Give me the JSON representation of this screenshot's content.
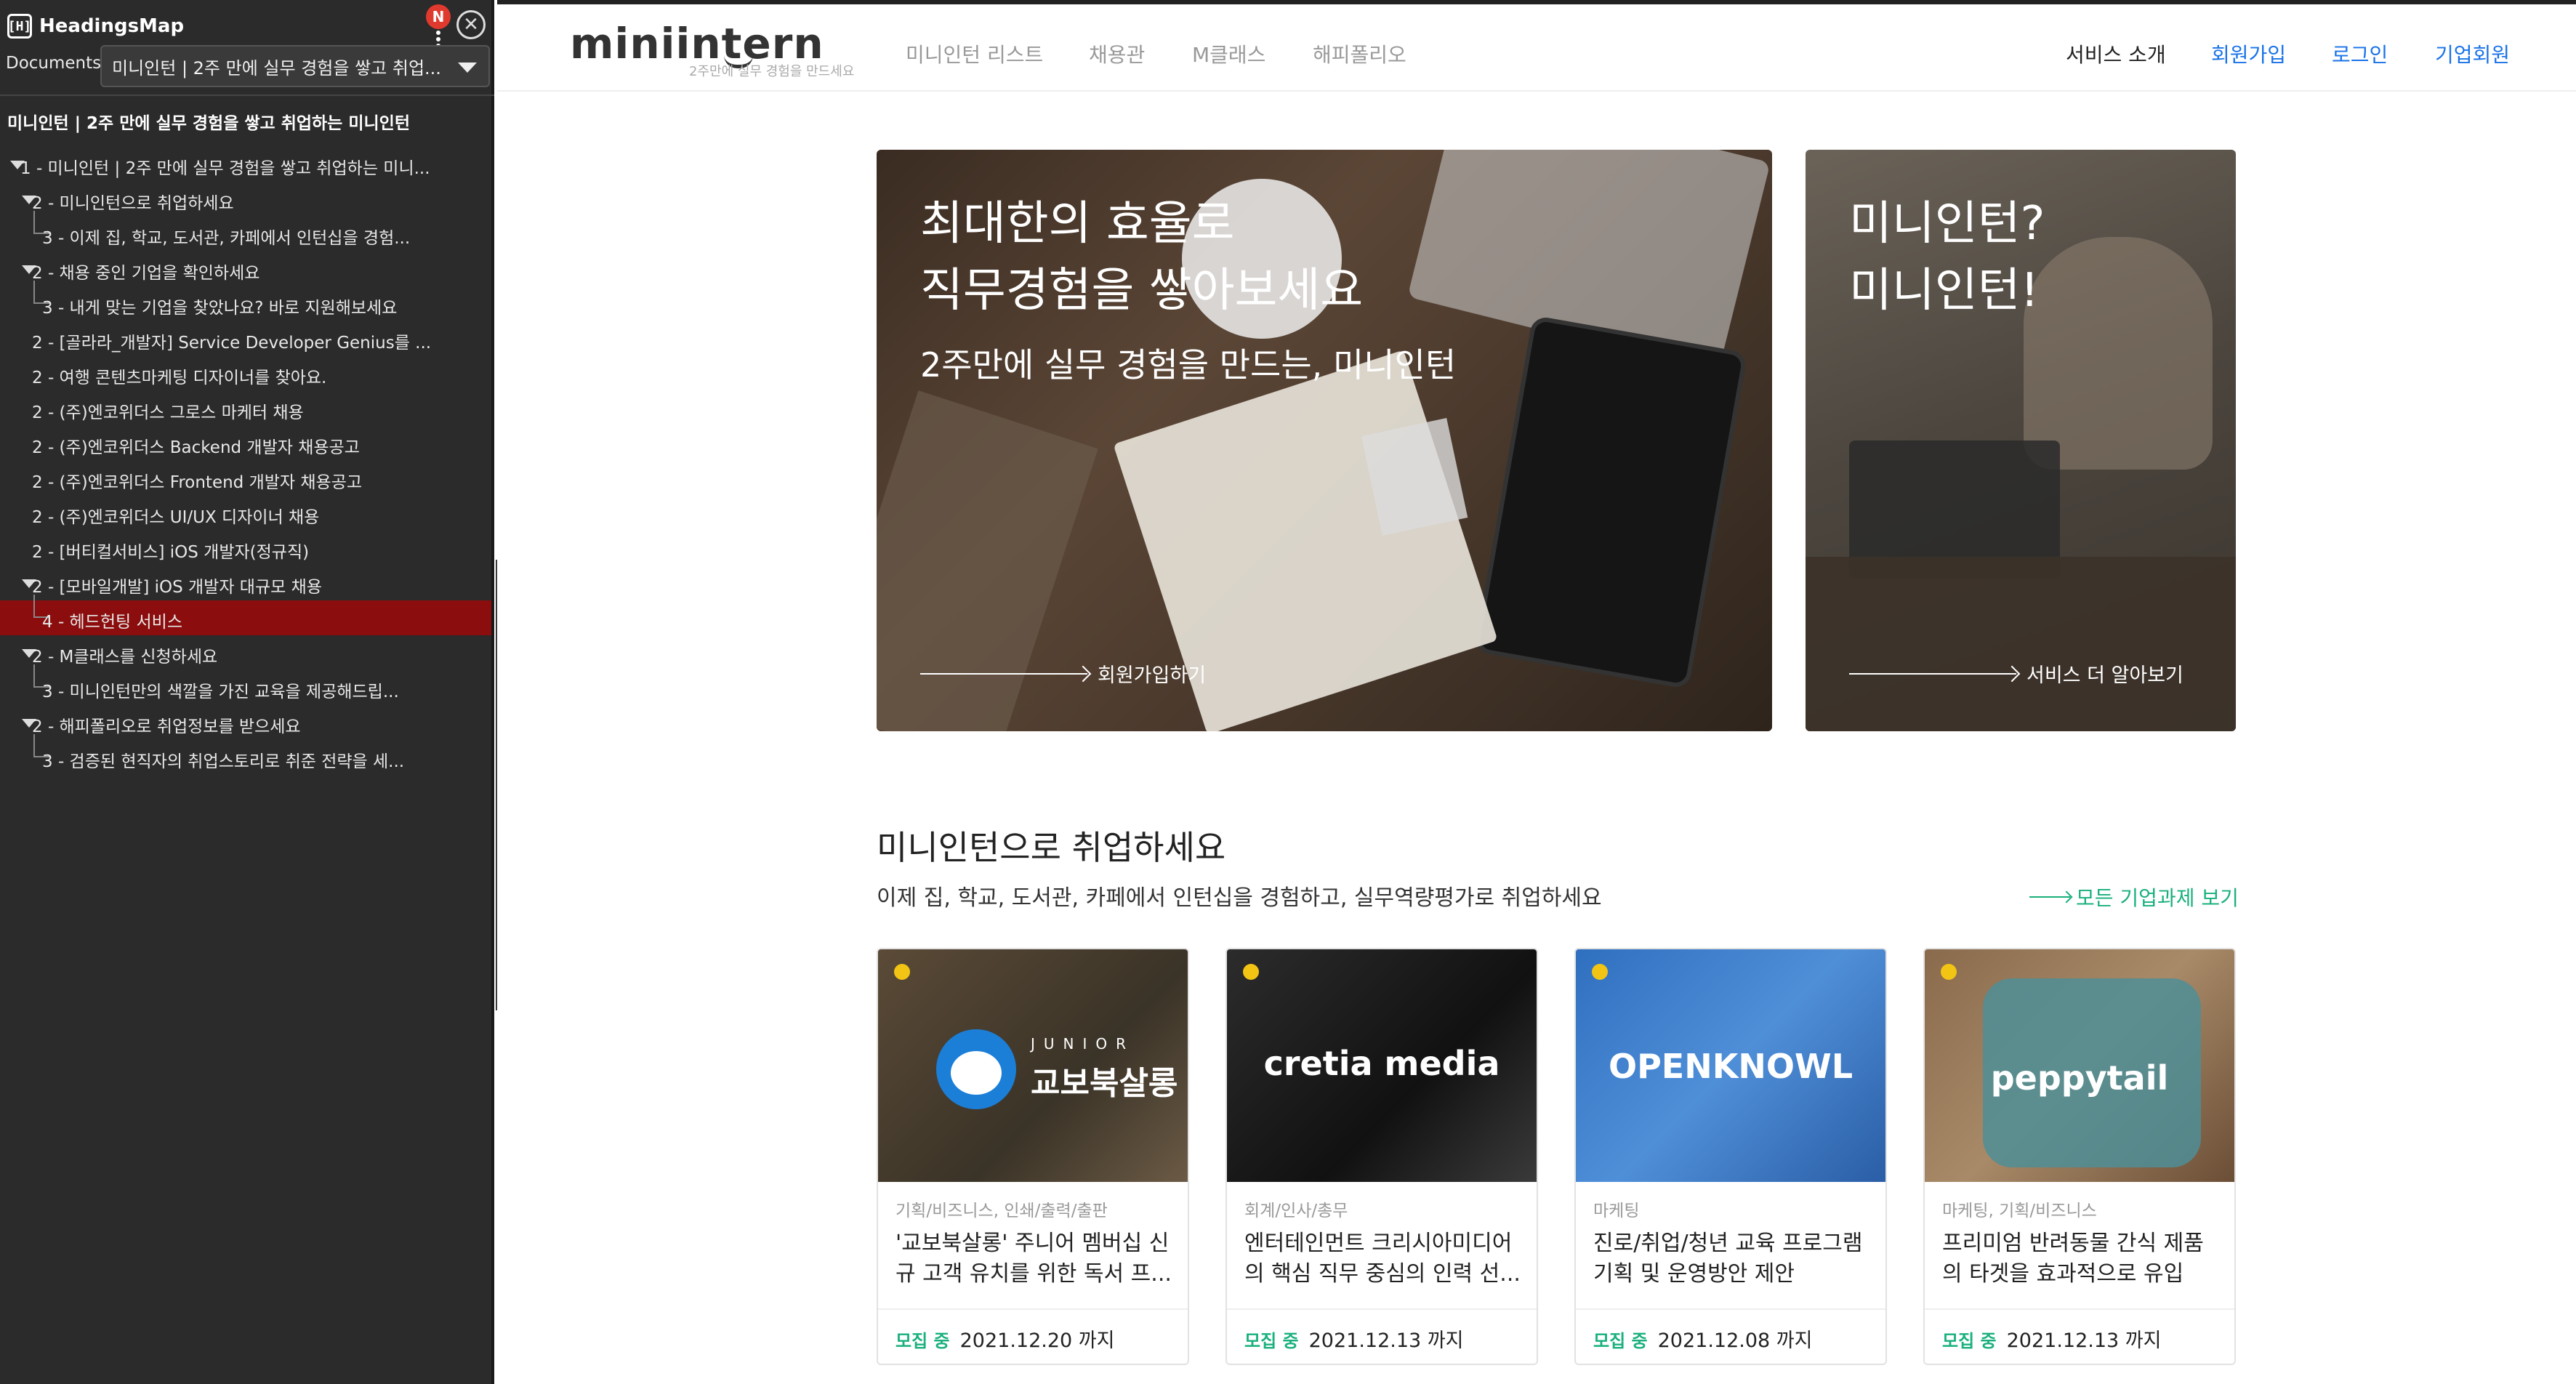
{
  "headingsmap": {
    "title": "HeadingsMap",
    "logo_text": "[H]",
    "notification_badge": "N",
    "documents_label": "Documents",
    "document_selected": "미니인턴 | 2주 만에 실무 경험을 쌓고 취업...",
    "page_title": "미니인턴 | 2주 만에 실무 경험을 쌓고 취업하는 미니인턴",
    "tree": [
      {
        "text": "1 - 미니인턴 | 2주 만에 실무 경험을 쌓고 취업하는 미니...",
        "level": 1,
        "expanded": true
      },
      {
        "text": "2 - 미니인턴으로 취업하세요",
        "level": 2,
        "expanded": true
      },
      {
        "text": "3 - 이제 집, 학교, 도서관, 카페에서 인턴십을 경험...",
        "level": 3
      },
      {
        "text": "2 - 채용 중인 기업을 확인하세요",
        "level": 2,
        "expanded": true
      },
      {
        "text": "3 - 내게 맞는 기업을 찾았나요? 바로 지원해보세요",
        "level": 3
      },
      {
        "text": "2 - [골라라_개발자] Service Developer Genius를 ...",
        "level": 2
      },
      {
        "text": "2 - 여행 콘텐츠마케팅 디자이너를 찾아요.",
        "level": 2
      },
      {
        "text": "2 - (주)엔코위더스 그로스 마케터 채용",
        "level": 2
      },
      {
        "text": "2 - (주)엔코위더스 Backend 개발자 채용공고",
        "level": 2
      },
      {
        "text": "2 - (주)엔코위더스 Frontend 개발자 채용공고",
        "level": 2
      },
      {
        "text": "2 - (주)엔코위더스 UI/UX 디자이너 채용",
        "level": 2
      },
      {
        "text": "2 - [버티컬서비스] iOS 개발자(정규직)",
        "level": 2
      },
      {
        "text": "2 - [모바일개발] iOS 개발자 대규모 채용",
        "level": 2,
        "expanded": true
      },
      {
        "text": "4 - 헤드헌팅 서비스",
        "level": 3,
        "selected": true
      },
      {
        "text": "2 - M클래스를 신청하세요",
        "level": 2,
        "expanded": true
      },
      {
        "text": "3 - 미니인턴만의 색깔을 가진 교육을 제공해드립...",
        "level": 3
      },
      {
        "text": "2 - 해피폴리오로 취업정보를 받으세요",
        "level": 2,
        "expanded": true
      },
      {
        "text": "3 - 검증된 현직자의 취업스토리로 취준 전략을 세...",
        "level": 3
      }
    ]
  },
  "site": {
    "logo": "miniintern",
    "logo_tagline": "2주만에 실무 경험을 만드세요",
    "nav_left": [
      "미니인턴 리스트",
      "채용관",
      "M클래스",
      "해피폴리오"
    ],
    "nav_right": [
      {
        "label": "서비스 소개",
        "color": "#222222"
      },
      {
        "label": "회원가입",
        "color": "#1a73e8"
      },
      {
        "label": "로그인",
        "color": "#1a73e8"
      },
      {
        "label": "기업회원",
        "color": "#1a73e8"
      }
    ]
  },
  "hero": {
    "main": {
      "title_line1": "최대한의 효율로",
      "title_line2": "직무경험을 쌓아보세요",
      "subtitle": "2주만에 실무 경험을 만드는, 미니인턴",
      "link": "회원가입하기"
    },
    "side": {
      "title_line1": "미니인턴?",
      "title_line2": "미니인턴!",
      "link": "서비스 더 알아보기"
    }
  },
  "section": {
    "title": "미니인턴으로 취업하세요",
    "description": "이제 집, 학교, 도서관, 카페에서 인턴십을 경험하고, 실무역량평가로 취업하세요",
    "more_link": "모든 기업과제 보기",
    "accent_color": "#19b07b"
  },
  "cards": [
    {
      "brand": "교보북살롱",
      "brand_sub": "JUNIOR",
      "category": "기획/비즈니스, 인쇄/출력/출판",
      "title": "'교보북살롱' 주니어 멤버십 신규 고객 유치를 위한 독서 프...",
      "status": "모집 중",
      "deadline": "2021.12.20 까지"
    },
    {
      "brand": "cretia media",
      "brand_sub": "",
      "category": "회계/인사/총무",
      "title": "엔터테인먼트 크리시아미디어의 핵심 직무 중심의 인력 선...",
      "status": "모집 중",
      "deadline": "2021.12.13 까지"
    },
    {
      "brand": "OPENKNOWL",
      "brand_sub": "",
      "category": "마케팅",
      "title": "진로/취업/청년 교육 프로그램 기획 및 운영방안 제안",
      "status": "모집 중",
      "deadline": "2021.12.08 까지"
    },
    {
      "brand": "peppytail",
      "brand_sub": "",
      "category": "마케팅, 기획/비즈니스",
      "title": "프리미엄 반려동물 간식 제품의 타겟을 효과적으로 유입시...",
      "status": "모집 중",
      "deadline": "2021.12.13 까지"
    }
  ]
}
